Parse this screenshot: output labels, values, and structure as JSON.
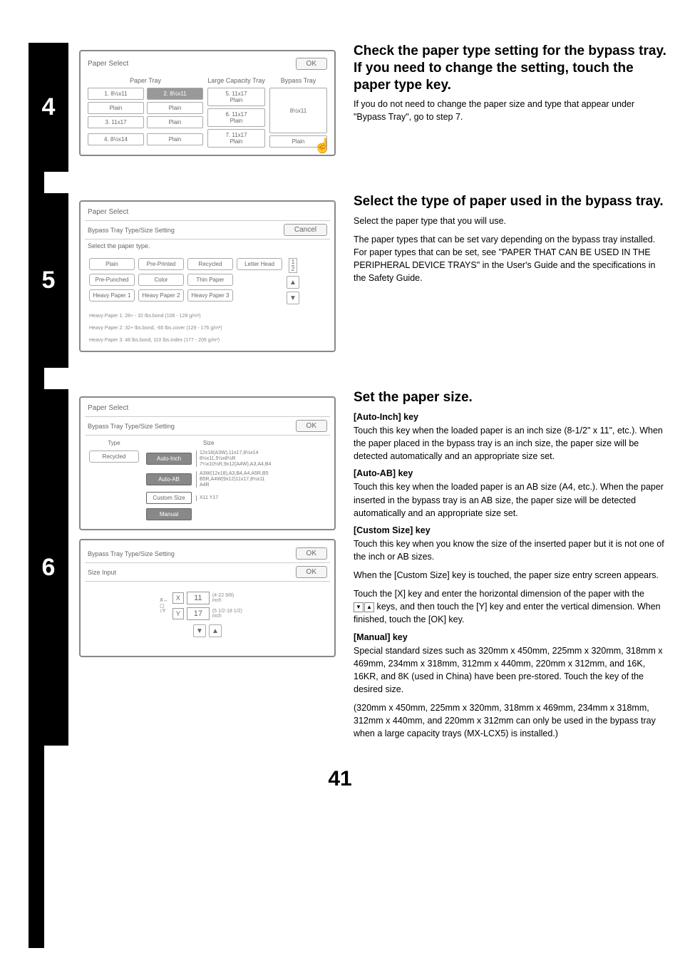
{
  "page_number": "41",
  "step4": {
    "num": "4",
    "dialog": {
      "title": "Paper Select",
      "ok": "OK",
      "paper_tray_label": "Paper Tray",
      "large_cap_label": "Large Capacity Tray",
      "bypass_label": "Bypass Tray",
      "cells": {
        "c1": "1. 8½x11",
        "c2": "2. 8½x11",
        "p1": "Plain",
        "p2": "Plain",
        "c3": "3. 11x17",
        "p3": "Plain",
        "c4": "4. 8½x14",
        "p4": "Plain",
        "c5": "5. 11x17",
        "p5": "Plain",
        "c6": "6. 11x17",
        "p6": "Plain",
        "c7": "7. 11x17",
        "p7": "Plain",
        "b1": "8½x11",
        "bp": "Plain"
      }
    },
    "heading": "Check the paper type setting for the bypass tray. If you need to change the setting, touch the paper type key.",
    "body": "If you do not need to change the paper size and type that appear under \"Bypass Tray\", go to step 7."
  },
  "step5": {
    "num": "5",
    "dialog": {
      "title": "Paper Select",
      "sub": "Bypass Tray Type/Size Setting",
      "cancel": "Cancel",
      "instruction": "Select the paper type.",
      "types": [
        "Plain",
        "Pre-Printed",
        "Recycled",
        "Letter Head",
        "Pre-Punched",
        "Color",
        "Thin Paper",
        "Heavy Paper 1",
        "Heavy Paper 2",
        "Heavy Paper 3"
      ],
      "frac_top": "1",
      "frac_bot": "2",
      "foot1": "Heavy Paper 1: 28+ - 32 lbs.bond (106 - 128 g/m²)",
      "foot2": "Heavy Paper 2: 32+ lbs.bond, -65 lbs.cover (129 - 176 g/m²)",
      "foot3": "Heavy Paper 3: 48 lbs.bond, 110 lbs.index (177 - 205 g/m²)"
    },
    "heading": "Select the type of paper used in the bypass tray.",
    "body1": "Select the paper type that you will use.",
    "body2": "The paper types that can be set vary depending on the bypass tray installed. For paper types that can be set, see \"PAPER THAT CAN BE USED IN THE PERIPHERAL DEVICE TRAYS\" in the User's Guide and the specifications in the Safety Guide."
  },
  "step6": {
    "num": "6",
    "dialog1": {
      "title": "Paper Select",
      "sub": "Bypass Tray Type/Size Setting",
      "ok": "OK",
      "type_label": "Type",
      "type_value": "Recycled",
      "size_label": "Size",
      "auto_inch": "Auto-Inch",
      "auto_inch_desc": "12x18(A3W),11x17,8½x14\n8½x11,5½x8½R\n7¼x10½R,9x12(A4W),A3,A4,B4",
      "auto_ab": "Auto-AB",
      "auto_ab_desc": "A3W(12x18),A3,B4,A4,A5R,B5\nB5R,A4W(9x12)11x17,8½x11\nA4R",
      "custom": "Custom Size",
      "custom_desc": "X11 Y17",
      "manual": "Manual"
    },
    "dialog2": {
      "sub": "Bypass Tray Type/Size Setting",
      "ok1": "OK",
      "size_input": "Size Input",
      "ok2": "OK",
      "x": "X",
      "xv": "11",
      "xrange": "(4-22 9/8)\ninch",
      "y": "Y",
      "yv": "17",
      "yrange": "(5 1/2-18 1/2)\ninch"
    },
    "heading": "Set the paper size.",
    "k1": "[Auto-Inch] key",
    "t1": "Touch this key when the loaded paper is an inch size (8-1/2\" x 11\", etc.). When the paper placed in the bypass tray is an inch size, the paper size will be detected automatically and an appropriate size set.",
    "k2": "[Auto-AB] key",
    "t2": "Touch this key when the loaded paper is an AB size (A4, etc.). When the paper inserted in the bypass tray is an AB size, the paper size will be detected automatically and an appropriate size set.",
    "k3": "[Custom Size] key",
    "t3a": "Touch this key when you know the size of the inserted paper but it is not one of the inch or AB sizes.",
    "t3b": "When the [Custom Size] key is touched, the paper size entry screen appears.",
    "t3c_a": "Touch the [X] key and enter the horizontal dimension of the paper with the ",
    "t3c_b": " keys, and then touch the [Y] key and enter the vertical dimension. When finished, touch the [OK] key.",
    "k4": "[Manual] key",
    "t4a": "Special standard sizes such as 320mm x 450mm, 225mm x 320mm, 318mm x 469mm, 234mm x 318mm, 312mm x 440mm, 220mm x 312mm, and 16K, 16KR, and 8K (used in China) have been pre-stored. Touch the key of the desired size.",
    "t4b": "(320mm x 450mm, 225mm x 320mm, 318mm x 469mm, 234mm x 318mm, 312mm x 440mm, and 220mm x 312mm can only be used in the bypass tray when a large capacity trays (MX-LCX5) is installed.)"
  }
}
